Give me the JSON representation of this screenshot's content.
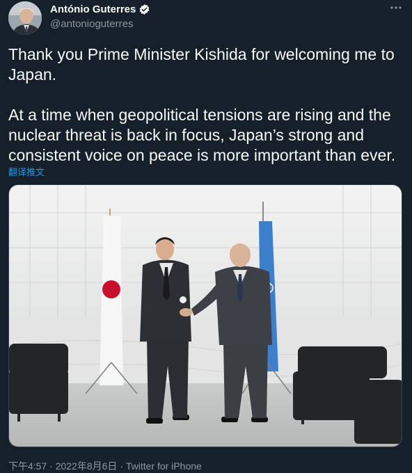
{
  "author": {
    "name": "António Guterres",
    "handle": "@antonioguterres"
  },
  "icons": {
    "verified": "verified-badge-icon",
    "more": "more-options-icon"
  },
  "colors": {
    "background": "#15202b",
    "text": "#f7f9f9",
    "secondary": "#8b98a5",
    "link": "#1d9bf0"
  },
  "tweet": {
    "paragraph1": "Thank you Prime Minister Kishida for welcoming me to Japan.",
    "paragraph2": "At a time when geopolitical tensions are rising and the nuclear threat is back in focus, Japan’s strong and consistent voice on peace is more important than ever.",
    "translate_label": "翻译推文"
  },
  "meta": {
    "time": "下午4:57",
    "date": "2022年8月6日",
    "source": "Twitter for iPhone"
  }
}
